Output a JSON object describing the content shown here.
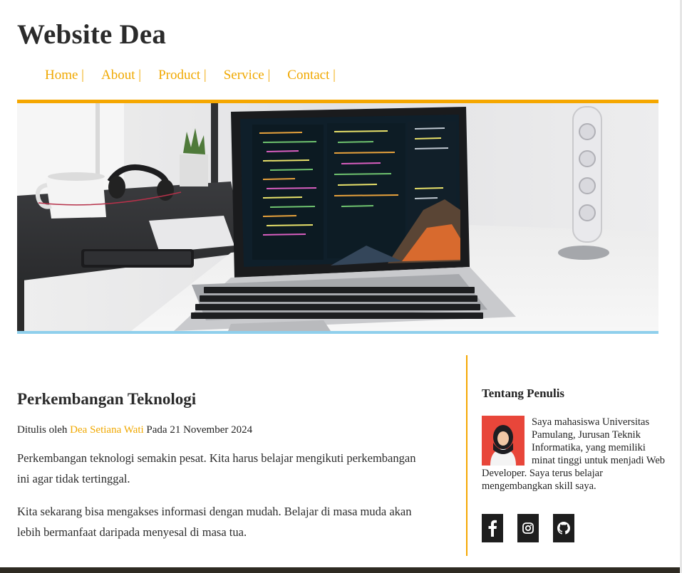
{
  "site": {
    "title": "Website Dea"
  },
  "nav": {
    "items": [
      {
        "label": "Home |"
      },
      {
        "label": "About |"
      },
      {
        "label": "Product |"
      },
      {
        "label": "Service |"
      },
      {
        "label": "Contact |"
      }
    ]
  },
  "colors": {
    "accent": "#f0a800",
    "accent_bar": "#f5a700",
    "hero_bottom_bar": "#8fcfec",
    "text": "#2b2b2b",
    "social_bg": "#1e1e1e"
  },
  "article": {
    "title": "Perkembangan Teknologi",
    "byline_prefix": "Ditulis oleh",
    "author": "Dea Setiana Wati",
    "byline_suffix": "Pada 21 November 2024",
    "paragraphs": [
      "Perkembangan teknologi semakin pesat. Kita harus belajar mengikuti perkembangan ini agar tidak tertinggal.",
      "Kita sekarang bisa mengakses informasi dengan mudah. Belajar di masa muda akan lebih bermanfaat daripada menyesal di masa tua."
    ]
  },
  "sidebar": {
    "title": "Tentang Penulis",
    "about": "Saya mahasiswa Universitas Pamulang, Jurusan Teknik Informatika, yang memiliki minat tinggi untuk menjadi Web Developer. Saya terus belajar mengembangkan skill saya.",
    "socials": [
      {
        "icon": "facebook-icon"
      },
      {
        "icon": "instagram-icon"
      },
      {
        "icon": "github-icon"
      }
    ]
  }
}
